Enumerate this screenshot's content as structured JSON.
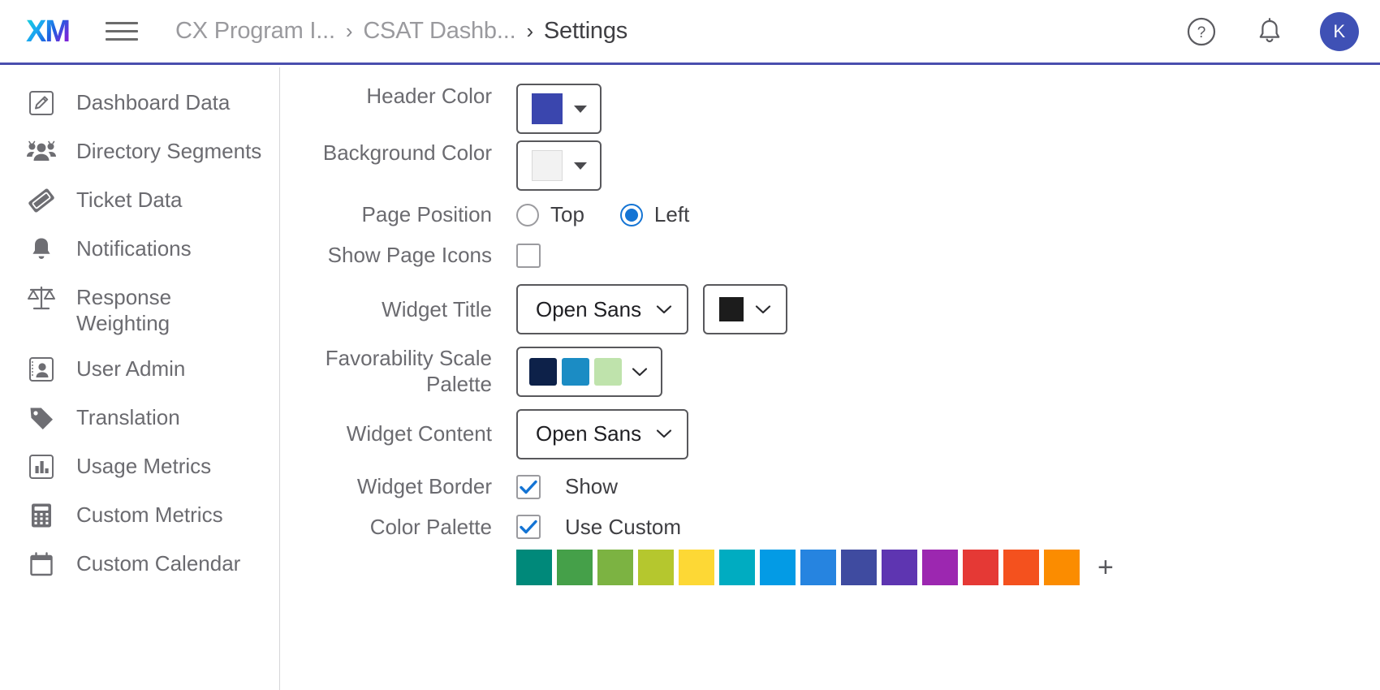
{
  "topbar": {
    "logo_text": "XM",
    "logo_name": "xm-logo",
    "menu_icon": "hamburger-menu-icon",
    "help_icon": "help-circle-icon",
    "notifications_icon": "bell-icon",
    "avatar_initial": "K",
    "avatar_color": "#3f51b5",
    "breadcrumb": [
      {
        "label": "CX Program I...",
        "current": false
      },
      {
        "label": "CSAT Dashb...",
        "current": false
      },
      {
        "label": "Settings",
        "current": true
      }
    ],
    "separator": "›",
    "accent_underline": "#4a4fae"
  },
  "sidebar": {
    "items": [
      {
        "label": "Dashboard Data",
        "icon": "pencil-square-icon"
      },
      {
        "label": "Directory Segments",
        "icon": "users-group-icon"
      },
      {
        "label": "Ticket Data",
        "icon": "ticket-icon"
      },
      {
        "label": "Notifications",
        "icon": "bell-icon"
      },
      {
        "label": "Response Weighting",
        "icon": "scales-balance-icon"
      },
      {
        "label": "User Admin",
        "icon": "user-card-icon"
      },
      {
        "label": "Translation",
        "icon": "tag-icon"
      },
      {
        "label": "Usage Metrics",
        "icon": "bar-chart-square-icon"
      },
      {
        "label": "Custom Metrics",
        "icon": "calculator-icon"
      },
      {
        "label": "Custom Calendar",
        "icon": "calendar-icon"
      }
    ]
  },
  "settings": {
    "header_color": {
      "label": "Header Color",
      "value": "#3a46ae",
      "chevron_icon": "chevron-down-icon"
    },
    "background_color": {
      "label": "Background Color",
      "value": "#f2f2f2",
      "chevron_icon": "chevron-down-icon"
    },
    "page_position": {
      "label": "Page Position",
      "options": [
        {
          "label": "Top",
          "selected": false
        },
        {
          "label": "Left",
          "selected": true
        }
      ],
      "selected": "Left"
    },
    "show_page_icons": {
      "label": "Show Page Icons",
      "checked": false
    },
    "widget_title": {
      "label": "Widget Title",
      "font": "Open Sans",
      "color": "#1c1c1c",
      "chevron_icon": "chevron-down-icon"
    },
    "favorability_scale_palette": {
      "label": "Favorability Scale Palette",
      "colors": [
        "#0d2149",
        "#1b8cc4",
        "#bfe3ac"
      ],
      "chevron_icon": "chevron-down-icon"
    },
    "widget_content": {
      "label": "Widget Content",
      "font": "Open Sans",
      "chevron_icon": "chevron-down-icon"
    },
    "widget_border": {
      "label": "Widget Border",
      "checkbox_label": "Show",
      "checked": true
    },
    "color_palette": {
      "label": "Color Palette",
      "checkbox_label": "Use Custom",
      "checked": true,
      "add_label": "+",
      "colors": [
        "#00897a",
        "#45a049",
        "#7cb342",
        "#b5c72e",
        "#fdd835",
        "#00acc1",
        "#039be5",
        "#2684e0",
        "#3f4ba0",
        "#5e35b1",
        "#9c27b0",
        "#e53935",
        "#f4511e",
        "#fb8c00"
      ]
    }
  }
}
